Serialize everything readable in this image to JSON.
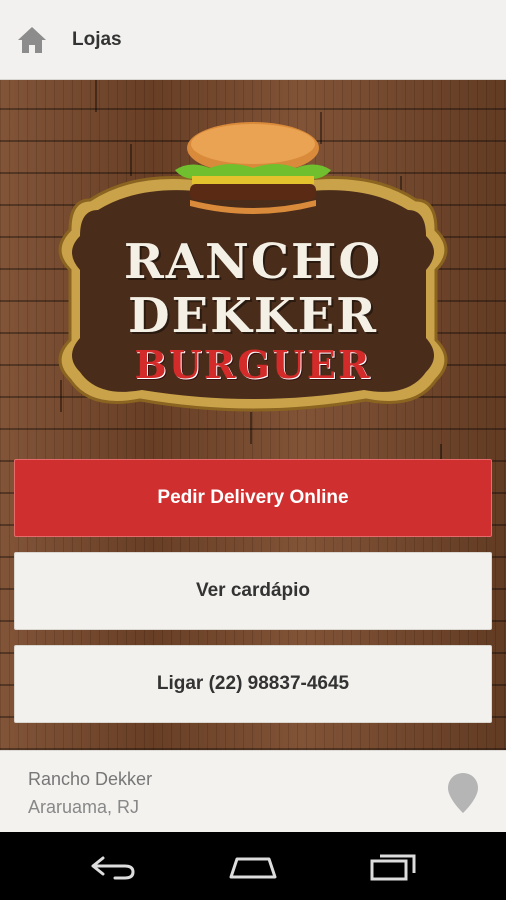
{
  "appbar": {
    "title": "Lojas",
    "home_icon": "home-icon"
  },
  "logo": {
    "line1": "RANCHO",
    "line2": "DEKKER",
    "line3": "BURGUER"
  },
  "actions": {
    "delivery_label": "Pedir Delivery Online",
    "menu_label": "Ver cardápio",
    "call_label": "Ligar (22) 98837-4645"
  },
  "store": {
    "name": "Rancho Dekker",
    "city": "Araruama, RJ",
    "icon": "location-pin-icon"
  },
  "navbar": {
    "back_icon": "back-icon",
    "home_icon": "home-nav-icon",
    "recents_icon": "recents-icon"
  },
  "colors": {
    "accent_red": "#cf2f2f",
    "appbar_bg": "#f2f1ef",
    "wood": "#7a4a2c"
  }
}
